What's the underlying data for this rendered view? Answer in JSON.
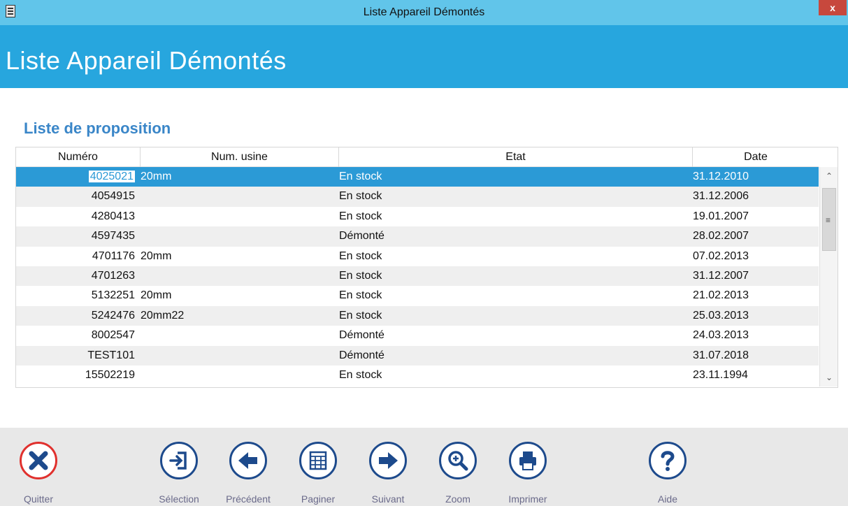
{
  "window": {
    "title": "Liste Appareil Démontés",
    "close_label": "x"
  },
  "header": {
    "title": "Liste Appareil Démontés"
  },
  "section": {
    "title": "Liste de proposition"
  },
  "table": {
    "columns": [
      "Numéro",
      "Num. usine",
      "Etat",
      "Date"
    ],
    "rows": [
      {
        "numero": "4025021",
        "usine": "20mm",
        "etat": "En stock",
        "date": "31.12.2010"
      },
      {
        "numero": "4054915",
        "usine": "",
        "etat": "En stock",
        "date": "31.12.2006"
      },
      {
        "numero": "4280413",
        "usine": "",
        "etat": "En stock",
        "date": "19.01.2007"
      },
      {
        "numero": "4597435",
        "usine": "",
        "etat": "Démonté",
        "date": "28.02.2007"
      },
      {
        "numero": "4701176",
        "usine": "20mm",
        "etat": "En stock",
        "date": "07.02.2013"
      },
      {
        "numero": "4701263",
        "usine": "",
        "etat": "En stock",
        "date": "31.12.2007"
      },
      {
        "numero": "5132251",
        "usine": "20mm",
        "etat": "En stock",
        "date": "21.02.2013"
      },
      {
        "numero": "5242476",
        "usine": "20mm22",
        "etat": "En stock",
        "date": "25.03.2013"
      },
      {
        "numero": "8002547",
        "usine": "",
        "etat": "Démonté",
        "date": "24.03.2013"
      },
      {
        "numero": "TEST101",
        "usine": "",
        "etat": "Démonté",
        "date": "31.07.2018"
      },
      {
        "numero": "15502219",
        "usine": "",
        "etat": "En stock",
        "date": "23.11.1994"
      }
    ],
    "selected_index": 0
  },
  "toolbar": {
    "quit": "Quitter",
    "selection": "Sélection",
    "previous": "Précédent",
    "paginate": "Paginer",
    "next": "Suivant",
    "zoom": "Zoom",
    "print": "Imprimer",
    "help": "Aide"
  },
  "icons": {
    "quit": "close-x-icon",
    "selection": "enter-icon",
    "previous": "arrow-left-icon",
    "paginate": "table-grid-icon",
    "next": "arrow-right-icon",
    "zoom": "zoom-in-icon",
    "print": "printer-icon",
    "help": "question-mark-icon"
  },
  "colors": {
    "titlebar": "#61c5ea",
    "header": "#27a6de",
    "selection": "#2b9ad6",
    "section_title": "#3a86c8",
    "icon": "#1d4a8c",
    "quit": "#e0302d"
  }
}
